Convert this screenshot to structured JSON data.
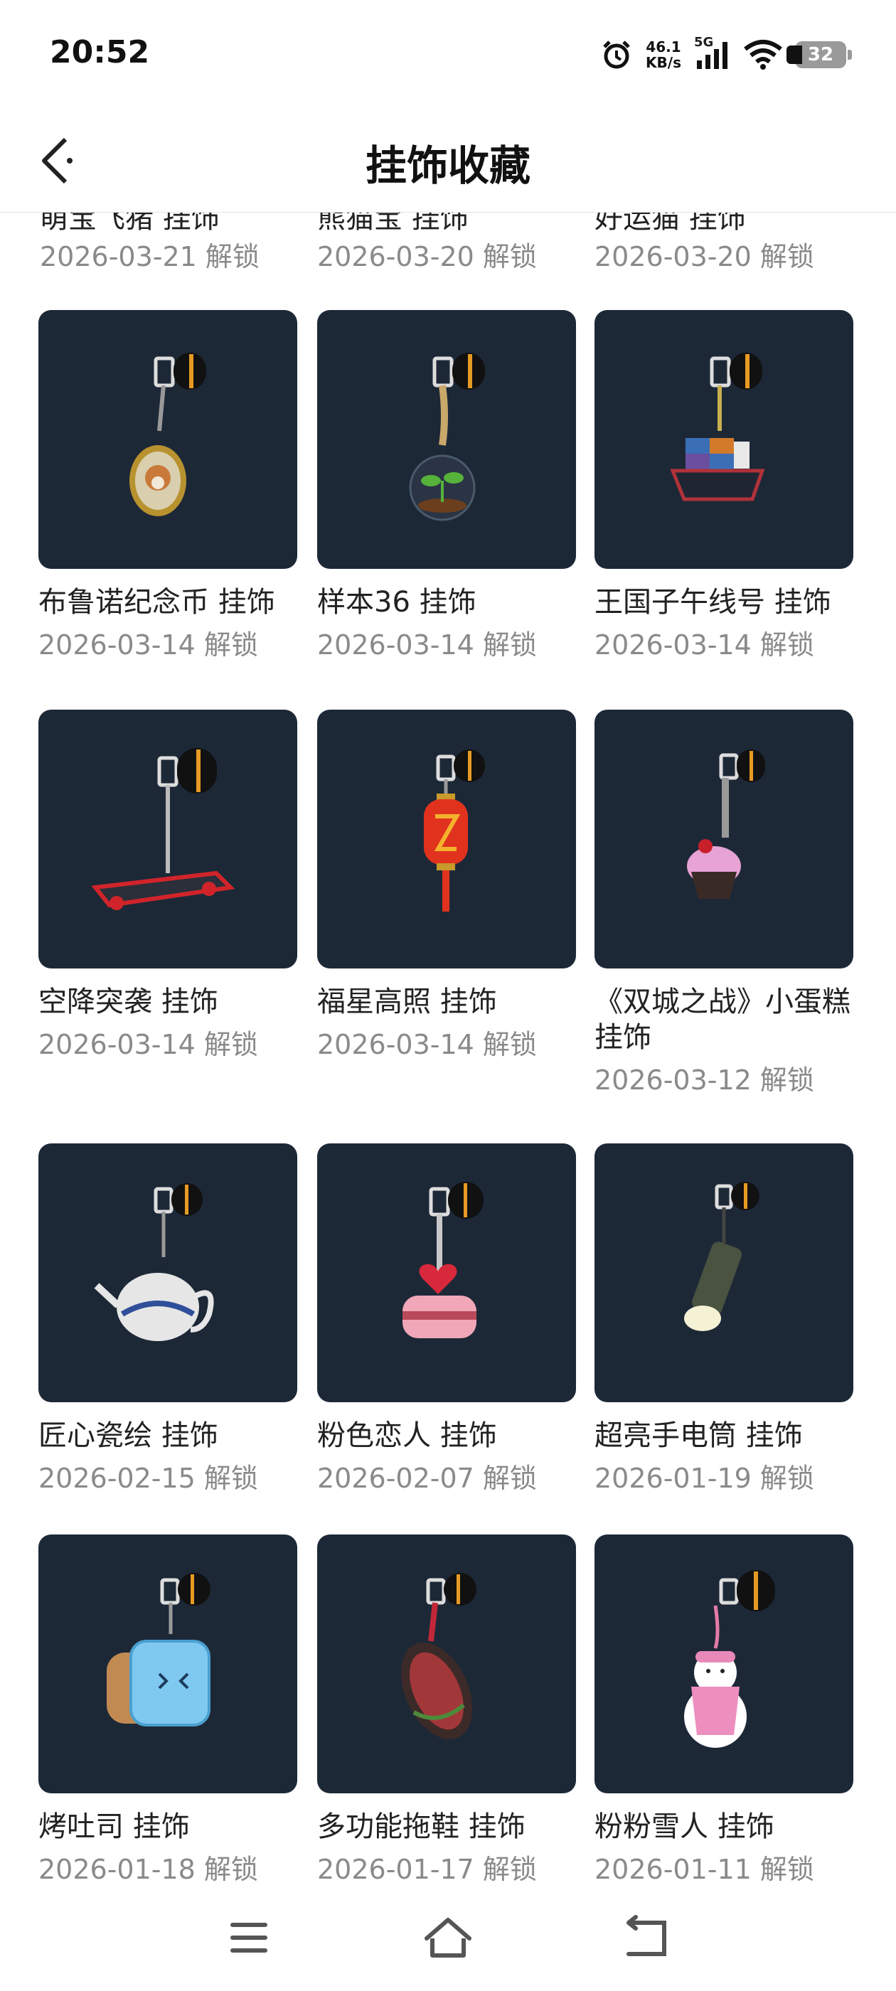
{
  "status_bar": {
    "time": "20:52",
    "speed_value": "46.1",
    "speed_unit": "KB/s",
    "network": "5G",
    "battery": "32",
    "icons": [
      "alarm-icon",
      "signal-icon",
      "wifi-icon",
      "battery-icon"
    ]
  },
  "header": {
    "title": "挂饰收藏",
    "back_icon": "chevron-left-icon"
  },
  "previous_row": {
    "names": [
      "萌宝飞猪 挂饰",
      "熊猫宝 挂饰",
      "好运猫 挂饰"
    ],
    "dates": [
      "2026-03-21 解锁",
      "2026-03-20 解锁",
      "2026-03-20 解锁"
    ]
  },
  "items": [
    {
      "name": "布鲁诺纪念币 挂饰",
      "date": "2026-03-14 解锁",
      "icon": "corgi-coin-charm"
    },
    {
      "name": "样本36 挂饰",
      "date": "2026-03-14 解锁",
      "icon": "terrarium-sprout-charm"
    },
    {
      "name": "王国子午线号 挂饰",
      "date": "2026-03-14 解锁",
      "icon": "cargo-ship-charm"
    },
    {
      "name": "空降突袭 挂饰",
      "date": "2026-03-14 解锁",
      "icon": "hoverboard-charm"
    },
    {
      "name": "福星高照 挂饰",
      "date": "2026-03-14 解锁",
      "icon": "red-lantern-charm"
    },
    {
      "name": "《双城之战》小蛋糕 挂饰",
      "date": "2026-03-12 解锁",
      "icon": "cupcake-charm"
    },
    {
      "name": "匠心瓷绘 挂饰",
      "date": "2026-02-15 解锁",
      "icon": "porcelain-teapot-charm"
    },
    {
      "name": "粉色恋人 挂饰",
      "date": "2026-02-07 解锁",
      "icon": "heart-cake-charm"
    },
    {
      "name": "超亮手电筒 挂饰",
      "date": "2026-01-19 解锁",
      "icon": "flashlight-charm"
    },
    {
      "name": "烤吐司 挂饰",
      "date": "2026-01-18 解锁",
      "icon": "toast-charm"
    },
    {
      "name": "多功能拖鞋 挂饰",
      "date": "2026-01-17 解锁",
      "icon": "slipper-charm"
    },
    {
      "name": "粉粉雪人 挂饰",
      "date": "2026-01-11 解锁",
      "icon": "pink-snowman-charm"
    }
  ],
  "nav_bar": {
    "icons": [
      "menu-icon",
      "home-icon",
      "back-icon"
    ]
  },
  "colors": {
    "card_bg": "#1d2837",
    "date_text": "#8a8a8a",
    "title_text": "#111111"
  }
}
